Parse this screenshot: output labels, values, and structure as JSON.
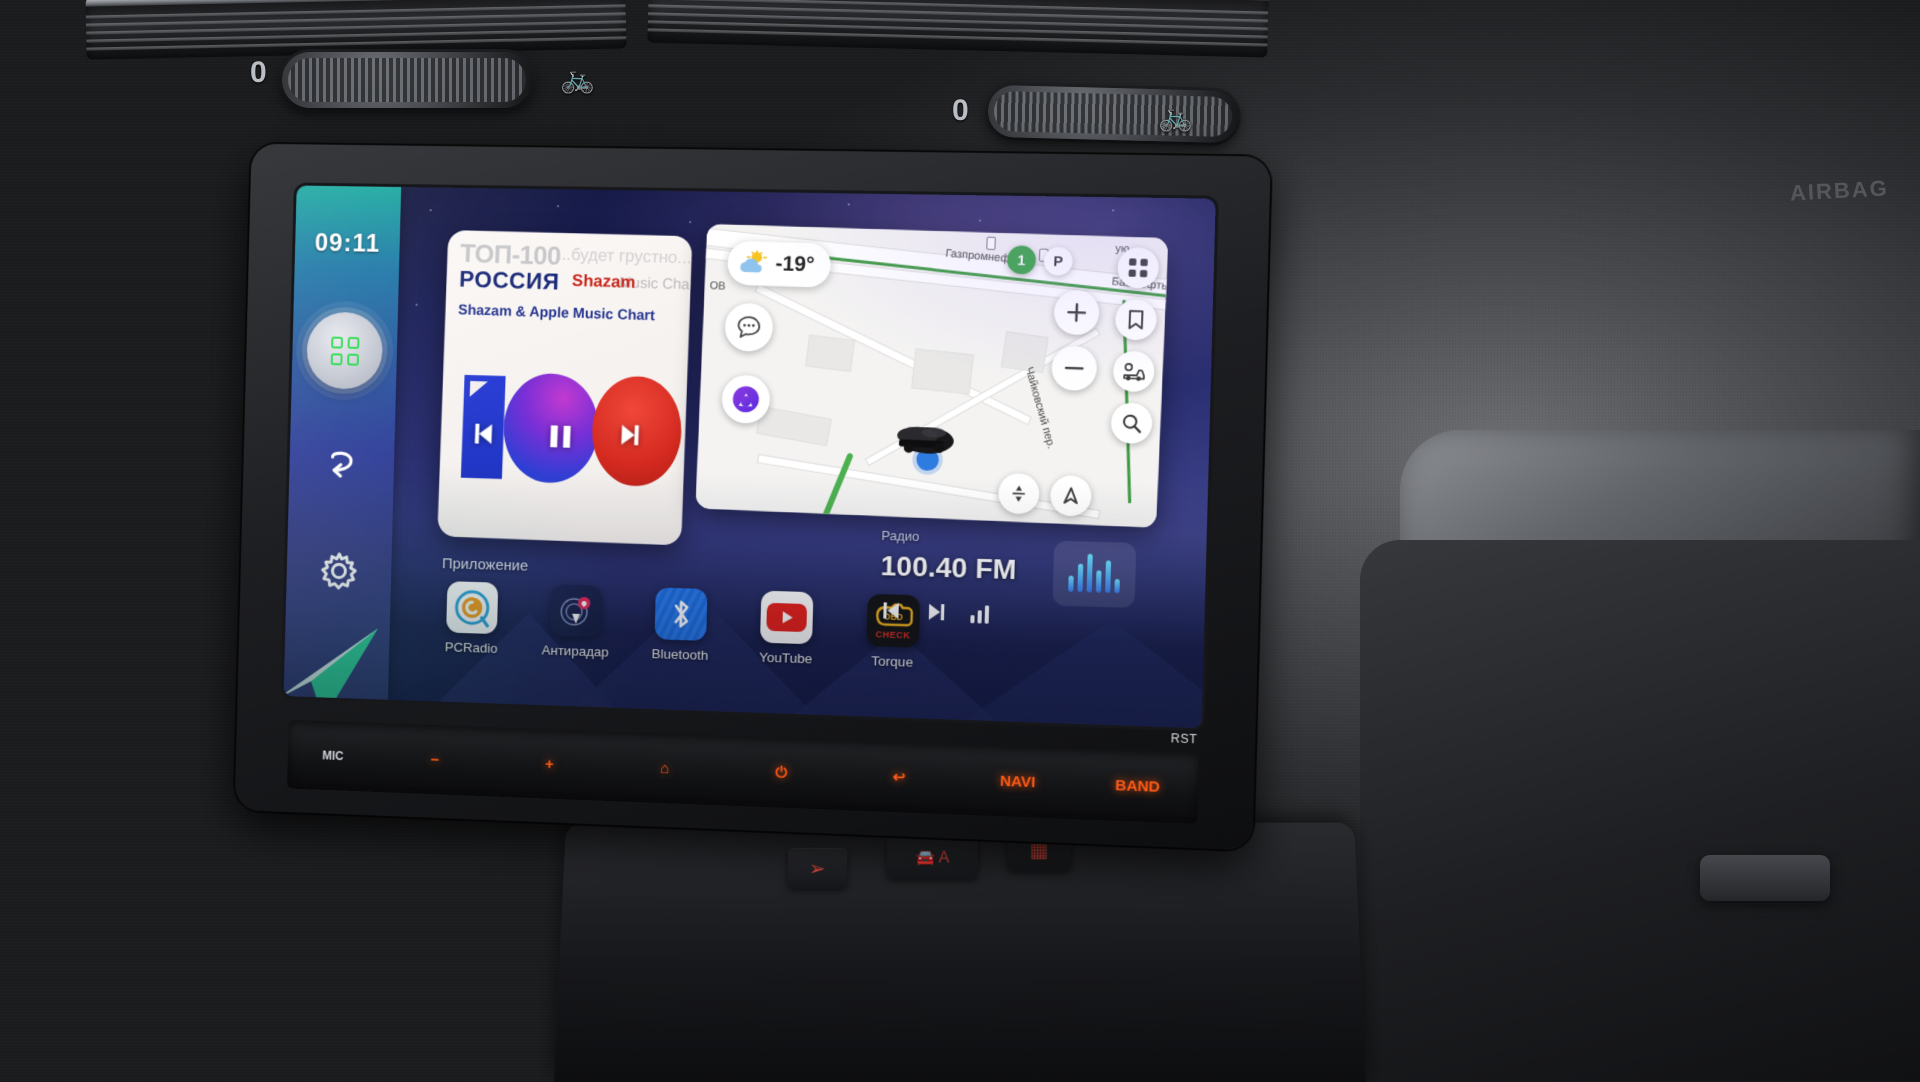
{
  "device": {
    "type": "android-car-head-unit",
    "dash_labels": {
      "airbag": "AIRBAG",
      "vent_knob_left": "0",
      "vent_knob_right": "0"
    }
  },
  "screen": {
    "status": {
      "clock": "09:11"
    },
    "rail": {
      "items": [
        {
          "name": "apps-grid",
          "icon": "grid-icon",
          "label": ""
        },
        {
          "name": "back",
          "icon": "back-arrow-icon",
          "label": ""
        },
        {
          "name": "settings",
          "icon": "gear-icon",
          "label": ""
        },
        {
          "name": "navigation",
          "icon": "paper-plane-icon",
          "label": ""
        }
      ]
    },
    "music_card": {
      "top_title": "ТОП-100",
      "country": "РОССИЯ",
      "shazam_tag": "Shazam",
      "ghost_line_1": "...будет грустно...",
      "ghost_line_2": "Music Chart (",
      "subtitle": "Shazam & Apple Music Chart",
      "artwork_text": "100",
      "controls": {
        "previous": "previous-track",
        "pause": "pause",
        "next": "next-track"
      }
    },
    "map_card": {
      "weather": {
        "temperature": "-19°",
        "icon": "sun-behind-cloud-icon"
      },
      "labels": [
        "Газпромнефть",
        "Башнефть",
        "Чайковский пер.",
        "ОВ",
        "ую"
      ],
      "badges": {
        "speed_limit": "1",
        "parking": "P"
      },
      "buttons": [
        {
          "name": "menu-grid",
          "icon": "grid-icon"
        },
        {
          "name": "bookmarks",
          "icon": "bookmark-icon"
        },
        {
          "name": "traffic-layer",
          "icon": "traffic-icon"
        },
        {
          "name": "search",
          "icon": "search-icon"
        },
        {
          "name": "zoom-in",
          "icon": "plus-icon"
        },
        {
          "name": "zoom-out",
          "icon": "minus-icon"
        },
        {
          "name": "recenter",
          "icon": "recenter-icon"
        },
        {
          "name": "compass-north",
          "icon": "north-arrow-icon"
        },
        {
          "name": "messages",
          "icon": "chat-bubble-icon"
        },
        {
          "name": "alice-assistant",
          "icon": "alice-icon"
        }
      ]
    },
    "apps": {
      "section_label": "Приложение",
      "items": [
        {
          "label": "PCRadio",
          "icon": "pcradio-icon",
          "color": "#f5a01e"
        },
        {
          "label": "Антирадар",
          "icon": "radar-icon",
          "color": "#e8265c"
        },
        {
          "label": "Bluetooth",
          "icon": "bluetooth-icon",
          "color": "#1e6fe0"
        },
        {
          "label": "YouTube",
          "icon": "youtube-icon",
          "color": "#e8211a"
        },
        {
          "label": "Torque",
          "icon": "obd-check-icon",
          "color": "#e8b71a"
        }
      ]
    },
    "radio_widget": {
      "title": "Радио",
      "frequency": "100.40 FM",
      "controls": [
        {
          "name": "prev-station",
          "icon": "previous-icon"
        },
        {
          "name": "next-station",
          "icon": "next-icon"
        },
        {
          "name": "station-list",
          "icon": "signal-bars-icon"
        }
      ],
      "equalizer": "equalizer-icon"
    }
  },
  "hardware_buttons": {
    "mic_label": "MIC",
    "rst_label": "RST",
    "keys": [
      {
        "label": "−",
        "name": "volume-down"
      },
      {
        "label": "+",
        "name": "volume-up"
      },
      {
        "label": "⌂",
        "name": "home"
      },
      {
        "label": "⏻",
        "name": "power"
      },
      {
        "label": "↩",
        "name": "back"
      },
      {
        "label": "NAVI",
        "name": "navi"
      },
      {
        "label": "BAND",
        "name": "band"
      }
    ]
  },
  "climate_console": {
    "keys": [
      {
        "label": "↯",
        "name": "defrost-front"
      },
      {
        "label": "A",
        "name": "auto-recirculation"
      },
      {
        "label": "▦",
        "name": "rear-defogger"
      }
    ]
  },
  "colors": {
    "rail_top": "#1aa9a0",
    "rail_bottom": "#2f3a74",
    "hw_button": "#ff5a14",
    "route_green": "#4bb14f",
    "accent_green": "#2ddc4e"
  }
}
